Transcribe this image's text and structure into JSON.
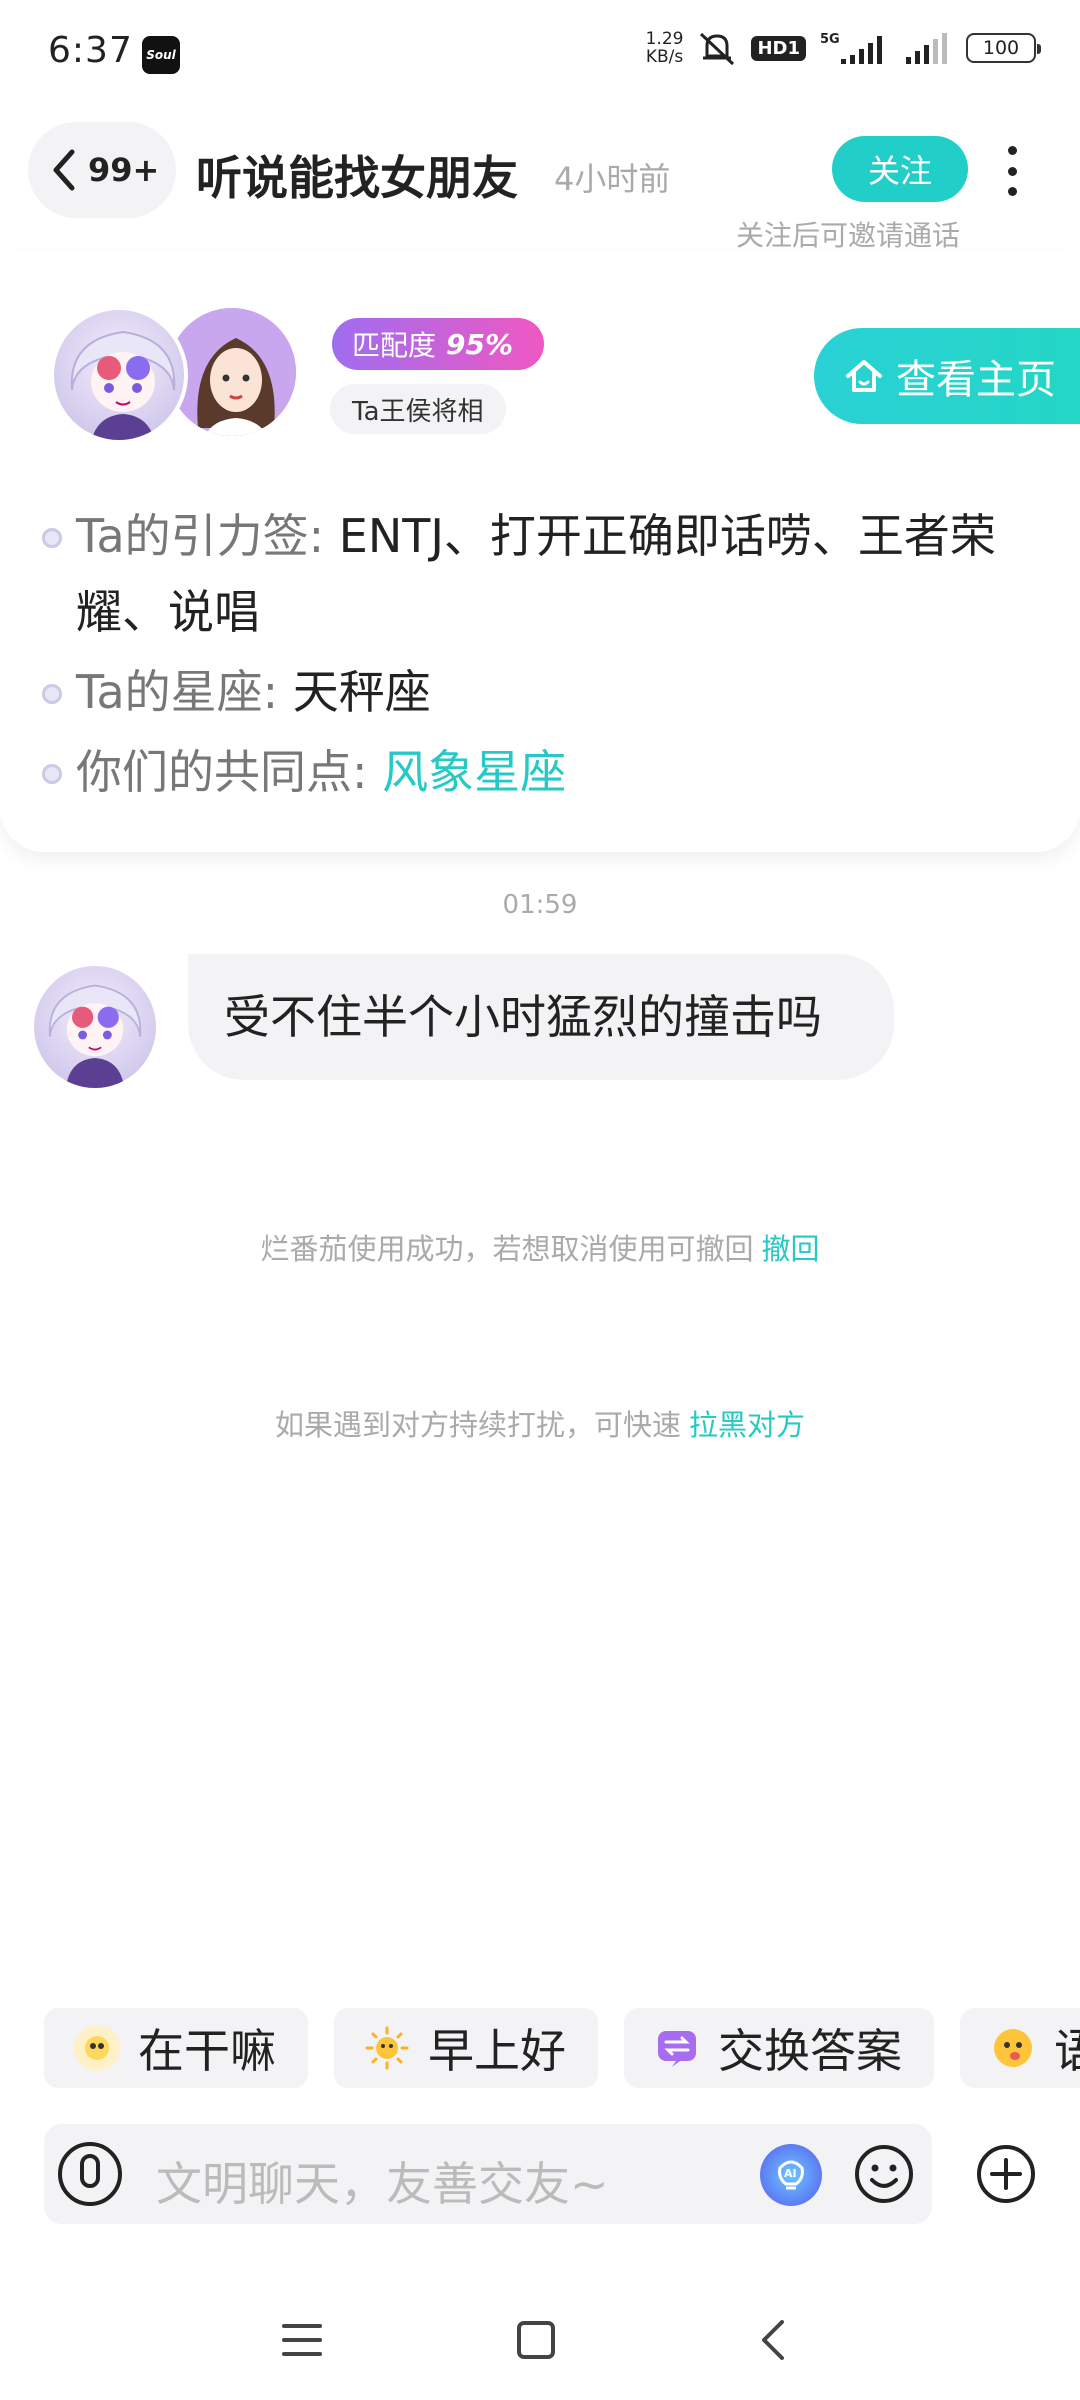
{
  "status_bar": {
    "time": "6:37",
    "app_icon_label": "Soul",
    "net_speed_value": "1.29",
    "net_speed_unit": "KB/s",
    "hd_label": "HD1",
    "network": "5G",
    "battery": "100"
  },
  "header": {
    "back_count": "99+",
    "title": "听说能找女朋友",
    "last_active": "4小时前",
    "follow_label": "关注",
    "follow_hint": "关注后可邀请通话"
  },
  "profile_card": {
    "match_label": "匹配度",
    "match_value": "95%",
    "nickname_tag": "Ta王侯将相",
    "home_button": "查看主页",
    "tags_label": "Ta的引力签:",
    "tags_value": "ENTJ、打开正确即话唠、王者荣耀、说唱",
    "zodiac_label": "Ta的星座:",
    "zodiac_value": "天秤座",
    "common_label": "你们的共同点:",
    "common_value": "风象星座"
  },
  "chat": {
    "timestamp": "01:59",
    "message": "受不住半个小时猛烈的撞击吗",
    "system_notice_1": "烂番茄使用成功，若想取消使用可撤回",
    "system_action_1": "撤回",
    "system_notice_2": "如果遇到对方持续打扰，可快速",
    "system_action_2": "拉黑对方"
  },
  "quick_replies": [
    {
      "label": "在干嘛",
      "icon": "ghost-icon"
    },
    {
      "label": "早上好",
      "icon": "sun-icon"
    },
    {
      "label": "交换答案",
      "icon": "swap-icon"
    },
    {
      "label": "语",
      "icon": "face-icon"
    }
  ],
  "input": {
    "placeholder": "文明聊天，友善交友~"
  },
  "colors": {
    "accent": "#26c9c6",
    "bubble": "#f3f3f5",
    "match_gradient_start": "#9f6df0",
    "match_gradient_end": "#f058c2"
  }
}
